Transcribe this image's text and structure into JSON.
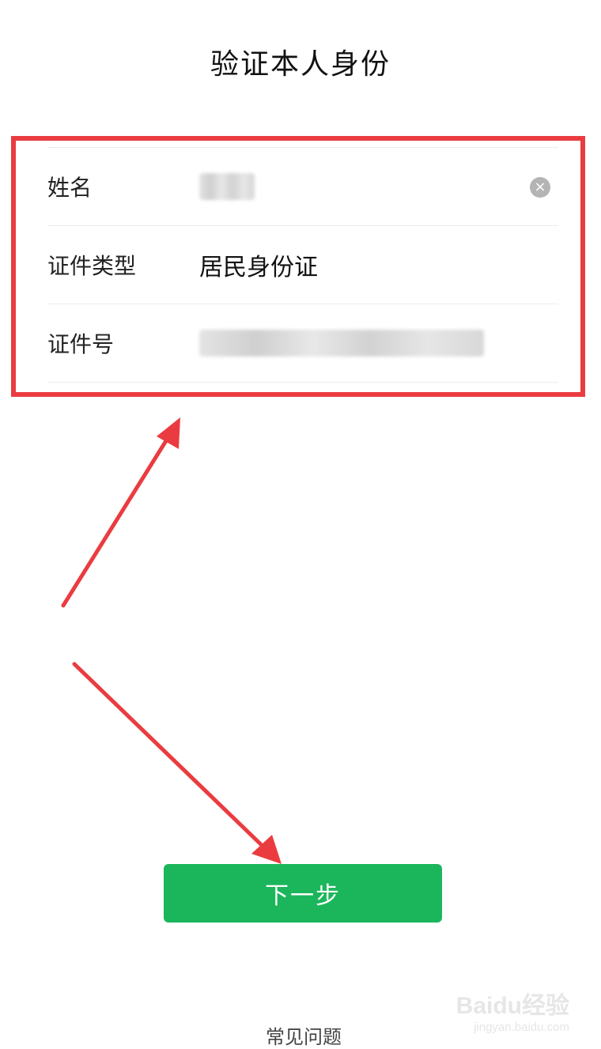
{
  "header": {
    "title": "验证本人身份"
  },
  "form": {
    "rows": [
      {
        "label": "姓名",
        "value": ""
      },
      {
        "label": "证件类型",
        "value": "居民身份证"
      },
      {
        "label": "证件号",
        "value": ""
      }
    ],
    "clear_icon": "clear-icon"
  },
  "actions": {
    "next_label": "下一步",
    "next_color": "#1bb65b"
  },
  "footer": {
    "faq_label": "常见问题"
  },
  "annotations": {
    "highlight_color": "#ea3c40",
    "arrow_color": "#ea3c40"
  },
  "watermark": {
    "main": "Baidu经验",
    "sub": "jingyan.baidu.com"
  }
}
